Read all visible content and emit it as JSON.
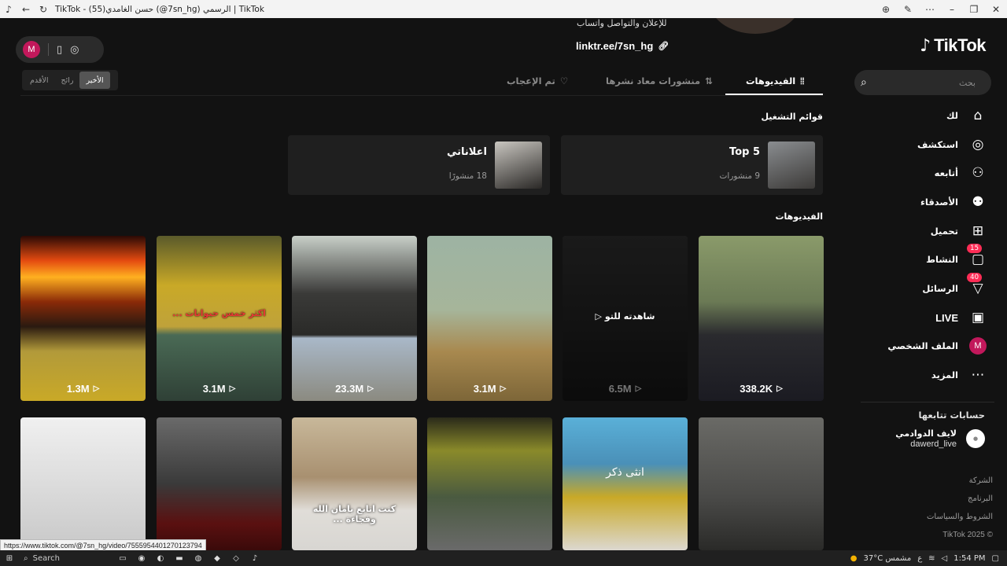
{
  "window": {
    "title": "TikTok - (55)حسن الغامدي (@7sn_hg) الرسمي | TikTok"
  },
  "profile": {
    "bio_line": "للإعلان والتواصل واتساب",
    "link": "linktr.ee/7sn_hg"
  },
  "tabs": [
    {
      "label": "الفيديوهات",
      "icon": "grid-icon",
      "active": true
    },
    {
      "label": "منشورات معاد نشرها",
      "icon": "repost-icon",
      "active": false
    },
    {
      "label": "تم الإعجاب",
      "icon": "heart-lock-icon",
      "active": false
    }
  ],
  "sort": {
    "options": [
      "الأخير",
      "رائج",
      "الأقدم"
    ],
    "selected": "الأخير"
  },
  "playlists": {
    "title": "قوائم التشغيل",
    "items": [
      {
        "name": "Top 5",
        "count": "9 منشورات"
      },
      {
        "name": "اعلاناتي",
        "count": "18 منشورًا"
      }
    ]
  },
  "videos": {
    "title": "الفيديوهات",
    "row1": [
      {
        "views": "338.2K"
      },
      {
        "views": "6.5M",
        "watched_label": "شاهدته للتو"
      },
      {
        "views": "3.1M"
      },
      {
        "views": "23.3M"
      },
      {
        "views": "3.1M",
        "caption": "اكثر خمس حيوانات ..."
      },
      {
        "views": "1.3M"
      }
    ],
    "row2": [
      {
        "caption": ""
      },
      {
        "caption": "انثى    ذكر"
      },
      {
        "caption": ""
      },
      {
        "caption": "كنت اتابع يامان الله وفجاءة ..."
      },
      {
        "caption": ""
      },
      {
        "caption": ""
      }
    ]
  },
  "sidebar": {
    "logo": "TikTok",
    "search_placeholder": "بحث",
    "nav": [
      {
        "label": "لك",
        "icon": "home-icon"
      },
      {
        "label": "استكشف",
        "icon": "compass-icon"
      },
      {
        "label": "أتابعه",
        "icon": "following-icon"
      },
      {
        "label": "الأصدقاء",
        "icon": "friends-icon"
      },
      {
        "label": "تحميل",
        "icon": "upload-icon"
      },
      {
        "label": "النشاط",
        "icon": "activity-icon",
        "badge": "15"
      },
      {
        "label": "الرسائل",
        "icon": "messages-icon",
        "badge": "40"
      },
      {
        "label": "LIVE",
        "icon": "live-icon"
      },
      {
        "label": "الملف الشخصي",
        "icon": "profile-avatar",
        "avatar_letter": "M"
      },
      {
        "label": "المزيد",
        "icon": "more-icon"
      }
    ],
    "following_title": "حسابات تتابعها",
    "following": [
      {
        "name": "لايف الدوادمي",
        "handle": "dawerd_live"
      }
    ],
    "footer_links": [
      "الشركة",
      "البرنامج",
      "الشروط والسياسات",
      "TikTok 2025 ©"
    ]
  },
  "floating_pill": {
    "avatar_letter": "M"
  },
  "status_url": "https://www.tiktok.com/@7sn_hg/video/7555954401270123794",
  "taskbar": {
    "search": "Search",
    "weather": "37°C  مشمس",
    "time": "1:54 PM",
    "lang": "ع"
  },
  "colors": {
    "background": "#121212",
    "accent": "#fe2c55",
    "avatar": "#c2185b"
  }
}
